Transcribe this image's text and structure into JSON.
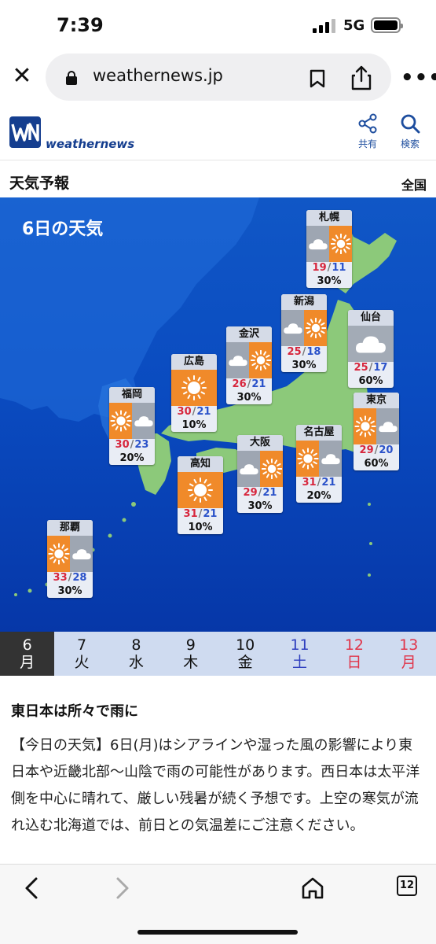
{
  "status": {
    "time": "7:39",
    "network": "5G"
  },
  "browser": {
    "url": "weathernews.jp"
  },
  "site": {
    "logo_text": "weathernews",
    "share_label": "共有",
    "search_label": "検索"
  },
  "section": {
    "title": "天気予報",
    "region": "全国"
  },
  "map": {
    "title": "6日の天気",
    "cities": [
      {
        "name": "札幌",
        "weather": "cloud-sun",
        "high": "19",
        "low": "11",
        "pop": "30%"
      },
      {
        "name": "新潟",
        "weather": "cloud-sun",
        "high": "25",
        "low": "18",
        "pop": "30%"
      },
      {
        "name": "仙台",
        "weather": "cloud",
        "high": "25",
        "low": "17",
        "pop": "60%"
      },
      {
        "name": "金沢",
        "weather": "cloud-sun",
        "high": "26",
        "low": "21",
        "pop": "30%"
      },
      {
        "name": "広島",
        "weather": "sun",
        "high": "30",
        "low": "21",
        "pop": "10%"
      },
      {
        "name": "福岡",
        "weather": "sun-cloud",
        "high": "30",
        "low": "23",
        "pop": "20%"
      },
      {
        "name": "東京",
        "weather": "sun-cloud",
        "high": "29",
        "low": "20",
        "pop": "60%"
      },
      {
        "name": "大阪",
        "weather": "cloud-sun",
        "high": "29",
        "low": "21",
        "pop": "30%"
      },
      {
        "name": "名古屋",
        "weather": "sun-cloud",
        "high": "31",
        "low": "21",
        "pop": "20%"
      },
      {
        "name": "高知",
        "weather": "sun",
        "high": "31",
        "low": "21",
        "pop": "10%"
      },
      {
        "name": "那覇",
        "weather": "sun-cloud",
        "high": "33",
        "low": "28",
        "pop": "30%"
      }
    ]
  },
  "dates": [
    {
      "day": "6",
      "weekday": "月",
      "type": "active"
    },
    {
      "day": "7",
      "weekday": "火",
      "type": "normal"
    },
    {
      "day": "8",
      "weekday": "水",
      "type": "normal"
    },
    {
      "day": "9",
      "weekday": "木",
      "type": "normal"
    },
    {
      "day": "10",
      "weekday": "金",
      "type": "normal"
    },
    {
      "day": "11",
      "weekday": "土",
      "type": "sat"
    },
    {
      "day": "12",
      "weekday": "日",
      "type": "sun"
    },
    {
      "day": "13",
      "weekday": "月",
      "type": "sun"
    }
  ],
  "article": {
    "headline": "東日本は所々で雨に",
    "body": "【今日の天気】6日(月)はシアラインや湿った風の影響により東日本や近畿北部〜山陰で雨の可能性があります。西日本は太平洋側を中心に晴れて、厳しい残暑が続く予想です。上空の寒気が流れ込む北海道では、前日との気温差にご注意ください。"
  },
  "toolbar": {
    "tab_count": "12"
  },
  "colors": {
    "sun": "#f08a2a",
    "cloud": "#9ea6b2",
    "high": "#d7263d",
    "low": "#2b52c9",
    "brand": "#153e8f",
    "sea": "#0a4bc0",
    "land": "#8cc97a"
  }
}
